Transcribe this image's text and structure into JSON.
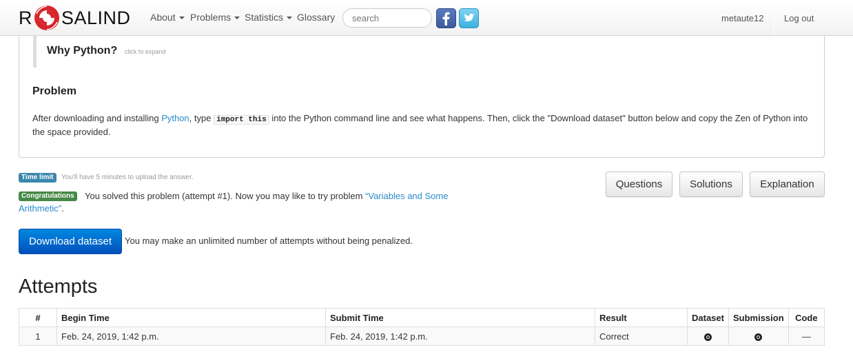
{
  "navbar": {
    "brand_left": "R",
    "brand_right": "SALIND",
    "menu": [
      {
        "label": "About",
        "dropdown": true
      },
      {
        "label": "Problems",
        "dropdown": true
      },
      {
        "label": "Statistics",
        "dropdown": true
      },
      {
        "label": "Glossary",
        "dropdown": false
      }
    ],
    "search_placeholder": "search",
    "social": [
      "facebook-icon",
      "twitter-icon"
    ],
    "username": "metaute12",
    "logout_label": "Log out"
  },
  "problem": {
    "why_title": "Why Python?",
    "why_hint": "click to expand",
    "heading": "Problem",
    "text_before_link": "After downloading and installing ",
    "link_text": "Python",
    "text_after_link": ", type ",
    "code": "import this",
    "text_after_code": " into the Python command line and see what happens. Then, click the \"Download dataset\" button below and copy the Zen of Python into the space provided."
  },
  "status": {
    "time_label": "Time limit",
    "time_text": "You'll have 5 minutes to upload the answer.",
    "success_label": "Congratulations",
    "success_text": "You solved this problem (attempt #1). Now you may like to try problem ",
    "next_problem": "“Variables and Some Arithmetic”",
    "success_end": "."
  },
  "buttons": {
    "questions": "Questions",
    "solutions": "Solutions",
    "explanation": "Explanation",
    "download": "Download dataset"
  },
  "attempt_note": "You may make an unlimited number of attempts without being penalized.",
  "attempts": {
    "title": "Attempts",
    "columns": [
      "#",
      "Begin Time",
      "Submit Time",
      "Result",
      "Dataset",
      "Submission",
      "Code"
    ],
    "rows": [
      {
        "num": "1",
        "begin": "Feb. 24, 2019, 1:42 p.m.",
        "submit": "Feb. 24, 2019, 1:42 p.m.",
        "result": "Correct",
        "code": "—"
      }
    ]
  },
  "colors": {
    "link": "#2a8ac9",
    "info": "#3a87ad",
    "success": "#468847",
    "primary": "#0066cc"
  }
}
